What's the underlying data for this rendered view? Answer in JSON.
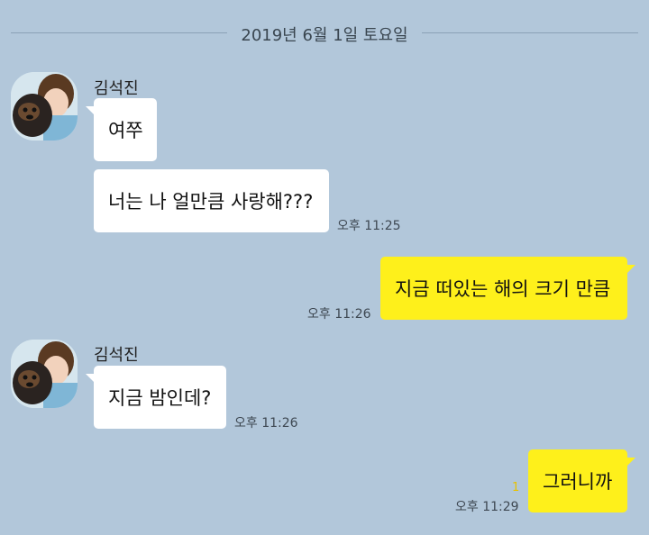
{
  "date_divider": "2019년 6월 1일 토요일",
  "conversation": {
    "group1": {
      "sender": "김석진",
      "msg1": "여쭈",
      "msg2": "너는 나 얼만큼 사랑해???",
      "time": "오후 11:25"
    },
    "reply1": {
      "text": "지금 떠있는 해의 크기 만큼",
      "time": "오후 11:26"
    },
    "group2": {
      "sender": "김석진",
      "msg1": "지금 밤인데?",
      "time": "오후 11:26"
    },
    "reply2": {
      "text": "그러니까",
      "unread": "1",
      "time": "오후 11:29"
    }
  },
  "colors": {
    "background": "#b2c7da",
    "incoming_bubble": "#ffffff",
    "outgoing_bubble": "#fef01b"
  },
  "icons": {
    "avatar": "profile-photo-person-with-dog"
  }
}
